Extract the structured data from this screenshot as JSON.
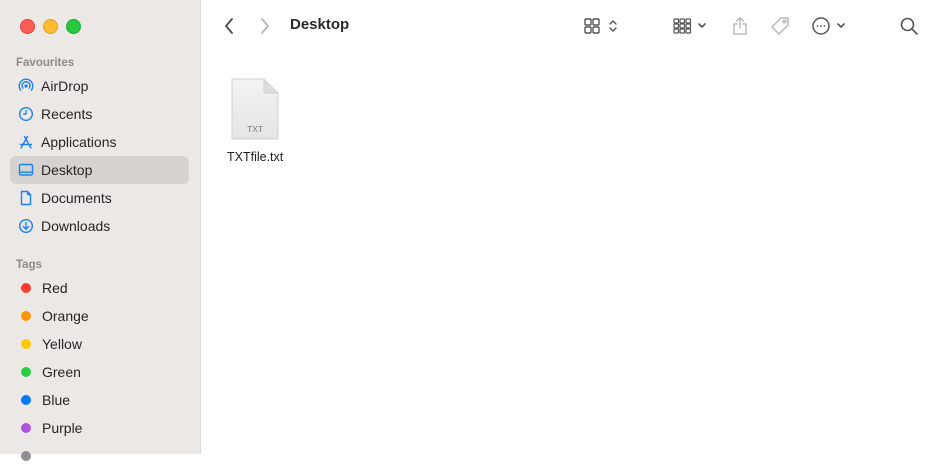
{
  "sidebar": {
    "favourites_title": "Favourites",
    "favourites": [
      {
        "label": "AirDrop",
        "icon": "airdrop-icon"
      },
      {
        "label": "Recents",
        "icon": "clock-icon"
      },
      {
        "label": "Applications",
        "icon": "applications-icon"
      },
      {
        "label": "Desktop",
        "icon": "desktop-icon",
        "selected": true
      },
      {
        "label": "Documents",
        "icon": "document-icon"
      },
      {
        "label": "Downloads",
        "icon": "download-icon"
      }
    ],
    "tags_title": "Tags",
    "tags": [
      {
        "label": "Red",
        "color": "#ff3b30"
      },
      {
        "label": "Orange",
        "color": "#ff9500"
      },
      {
        "label": "Yellow",
        "color": "#ffcc00"
      },
      {
        "label": "Green",
        "color": "#28cd41"
      },
      {
        "label": "Blue",
        "color": "#007aff"
      },
      {
        "label": "Purple",
        "color": "#af52de"
      }
    ]
  },
  "toolbar": {
    "title": "Desktop"
  },
  "files": [
    {
      "name": "TXTfile.txt",
      "badge": "TXT"
    }
  ],
  "colors": {
    "accent": "#007aff",
    "sidebar_bg": "#ece8e6",
    "selected_bg": "#d6d2d0"
  }
}
